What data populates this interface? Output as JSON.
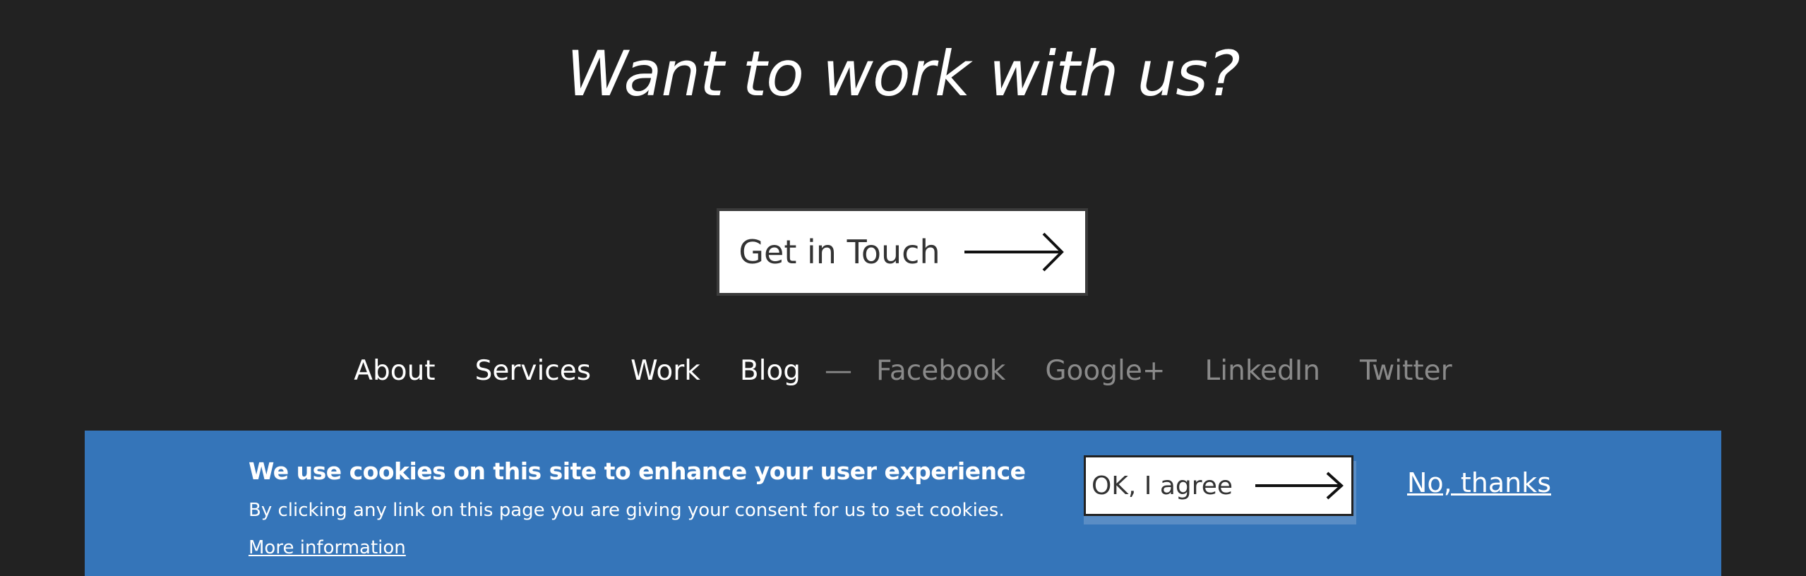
{
  "cta_section": {
    "headline": "Want to work with us?",
    "button_label": "Get in Touch"
  },
  "footer_nav": {
    "primary": [
      {
        "label": "About"
      },
      {
        "label": "Services"
      },
      {
        "label": "Work"
      },
      {
        "label": "Blog"
      }
    ],
    "separator": "—",
    "social": [
      {
        "label": "Facebook"
      },
      {
        "label": "Google+"
      },
      {
        "label": "LinkedIn"
      },
      {
        "label": "Twitter"
      }
    ]
  },
  "cookie_banner": {
    "title": "We use cookies on this site to enhance your user experience",
    "description": "By clicking any link on this page you are giving your consent for us to set cookies.",
    "more_info_label": "More information",
    "agree_label": "OK, I agree",
    "decline_label": "No, thanks"
  },
  "colors": {
    "page_background": "#222222",
    "cookie_banner_background": "#3575b9",
    "social_link": "#8a8a8a",
    "primary_link": "#ffffff"
  }
}
